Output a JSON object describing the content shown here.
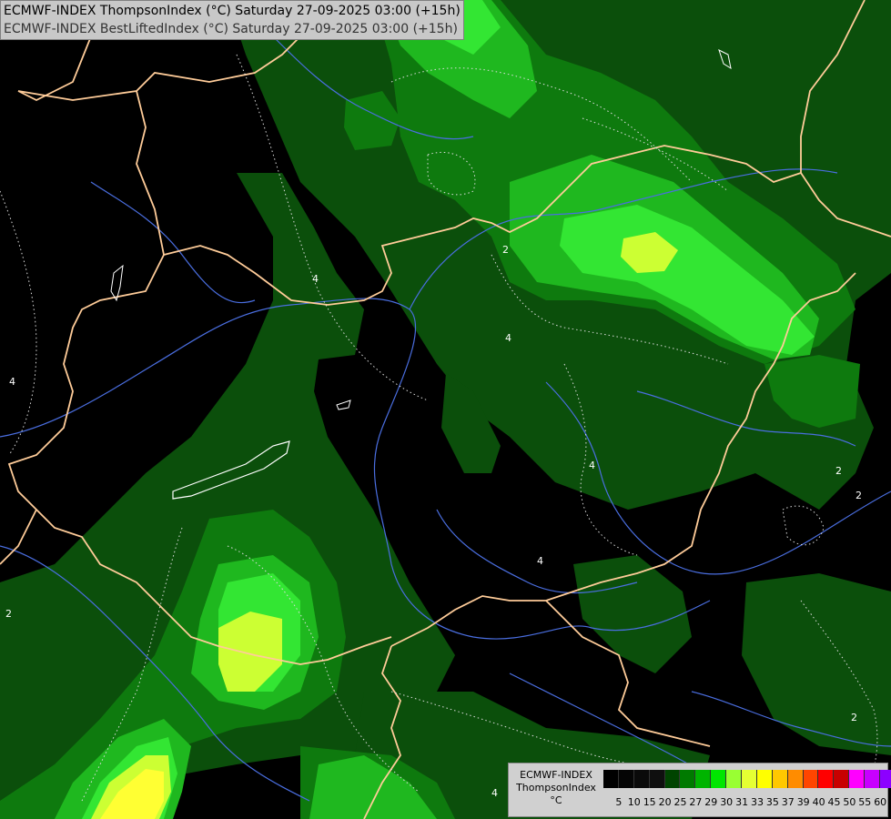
{
  "header": {
    "line1": "ECMWF-INDEX ThompsonIndex (°C) Saturday 27-09-2025 03:00 (+15h)",
    "line2": "ECMWF-INDEX BestLiftedIndex (°C) Saturday 27-09-2025 03:00 (+15h)"
  },
  "legend": {
    "model": "ECMWF-INDEX",
    "field": "ThompsonIndex",
    "unit": "°C",
    "ticks": [
      "5",
      "10",
      "15",
      "20",
      "25",
      "27",
      "29",
      "30",
      "31",
      "33",
      "35",
      "37",
      "39",
      "40",
      "45",
      "50",
      "55",
      "60"
    ],
    "colors": [
      "#000000",
      "#050505",
      "#0a0a0a",
      "#0f0f0f",
      "#004400",
      "#007a00",
      "#00b400",
      "#00e600",
      "#99ff33",
      "#e5ff33",
      "#ffff00",
      "#ffc800",
      "#ff8c00",
      "#ff4500",
      "#ff0000",
      "#c80000",
      "#ff00ff",
      "#c800ff",
      "#8c00ff",
      "#6400ff",
      "#0000ff"
    ]
  },
  "map": {
    "contour_labels": [
      "4",
      "4",
      "4",
      "4",
      "2",
      "2",
      "2",
      "2",
      "2",
      "4",
      "4"
    ],
    "colors": {
      "background": "#000000",
      "dark_green": "#0b4f0b",
      "mid_green": "#0e7a0e",
      "bright_green": "#1fb81f",
      "lime": "#33e633",
      "yellow_green": "#ccff33",
      "yellow": "#ffff33",
      "border": "#ffcc99",
      "river": "#4a6ee0"
    }
  }
}
